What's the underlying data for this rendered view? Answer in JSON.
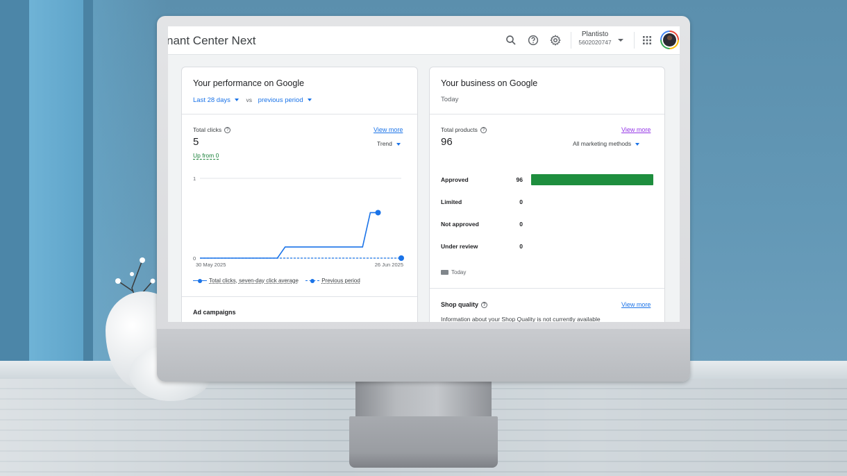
{
  "header": {
    "app_title": "nant Center Next",
    "account_name": "Plantisto",
    "account_id": "5602020747"
  },
  "performance": {
    "title": "Your performance on Google",
    "range_label": "Last 28 days",
    "vs_label": "vs",
    "compare_label": "previous period",
    "metric_label": "Total clicks",
    "metric_value": "5",
    "change_label": "Up from 0",
    "view_more": "View more",
    "trend_label": "Trend",
    "legend_current": "Total clicks, seven-day click average",
    "legend_previous": "Previous period"
  },
  "chart_data": {
    "type": "line",
    "x_tick_labels": [
      "30 May 2025",
      "26 Jun 2025"
    ],
    "y_tick_labels": [
      "1",
      "0"
    ],
    "ylim": [
      0,
      1
    ],
    "series": [
      {
        "name": "Total clicks, seven-day click average",
        "x": [
          0,
          10,
          11,
          21,
          22,
          23
        ],
        "values": [
          0,
          0,
          0.14,
          0.14,
          0.57,
          0.57
        ]
      },
      {
        "name": "Previous period",
        "x": [
          0,
          26
        ],
        "values": [
          0,
          0
        ]
      }
    ]
  },
  "ad_campaigns": {
    "title": "Ad campaigns"
  },
  "business": {
    "title": "Your business on Google",
    "subtitle": "Today",
    "metric_label": "Total products",
    "metric_value": "96",
    "view_more": "View more",
    "filter_label": "All marketing methods",
    "statuses": [
      {
        "label": "Approved",
        "value": "96",
        "fraction": 1.0
      },
      {
        "label": "Limited",
        "value": "0",
        "fraction": 0
      },
      {
        "label": "Not approved",
        "value": "0",
        "fraction": 0
      },
      {
        "label": "Under review",
        "value": "0",
        "fraction": 0
      }
    ],
    "legend_today": "Today",
    "bar_color": "#1e8e3e"
  },
  "shop_quality": {
    "title": "Shop quality",
    "view_more": "View more",
    "message": "Information about your Shop Quality is not currently available"
  },
  "colors": {
    "accent": "#1a73e8",
    "positive": "#188038",
    "link_visited": "#9334e6"
  }
}
